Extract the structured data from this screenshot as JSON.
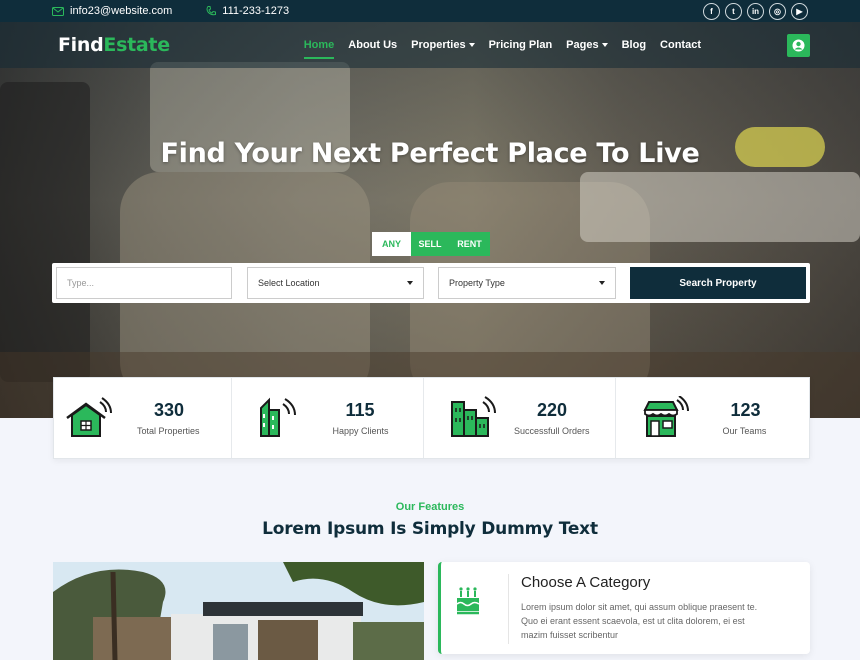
{
  "topbar": {
    "email": "info23@website.com",
    "phone": "111-233-1273",
    "socials": [
      {
        "name": "facebook-icon",
        "glyph": "f"
      },
      {
        "name": "twitter-icon",
        "glyph": "t"
      },
      {
        "name": "linkedin-icon",
        "glyph": "in"
      },
      {
        "name": "instagram-icon",
        "glyph": "◎"
      },
      {
        "name": "youtube-icon",
        "glyph": "▶"
      }
    ]
  },
  "brand": {
    "part1": "Find",
    "part2": "Estate"
  },
  "nav": {
    "items": [
      {
        "label": "Home",
        "active": true,
        "dropdown": false
      },
      {
        "label": "About Us",
        "active": false,
        "dropdown": false
      },
      {
        "label": "Properties",
        "active": false,
        "dropdown": true
      },
      {
        "label": "Pricing Plan",
        "active": false,
        "dropdown": false
      },
      {
        "label": "Pages",
        "active": false,
        "dropdown": true
      },
      {
        "label": "Blog",
        "active": false,
        "dropdown": false
      },
      {
        "label": "Contact",
        "active": false,
        "dropdown": false
      }
    ]
  },
  "hero": {
    "title": "Find Your Next Perfect Place To Live",
    "tabs": [
      "ANY",
      "SELL",
      "RENT"
    ],
    "search": {
      "type_placeholder": "Type...",
      "location_value": "Select Location",
      "property_type_value": "Property Type",
      "button_label": "Search Property"
    }
  },
  "stats": [
    {
      "value": "330",
      "label": "Total Properties",
      "icon": "house-signal-icon"
    },
    {
      "value": "115",
      "label": "Happy Clients",
      "icon": "building-signal-icon"
    },
    {
      "value": "220",
      "label": "Successfull Orders",
      "icon": "city-signal-icon"
    },
    {
      "value": "123",
      "label": "Our Teams",
      "icon": "store-signal-icon"
    }
  ],
  "features": {
    "eyebrow": "Our Features",
    "title": "Lorem Ipsum Is Simply Dummy Text",
    "card": {
      "title": "Choose A Category",
      "text": "Lorem ipsum dolor sit amet, qui assum oblique praesent te. Quo ei erant essent scaevola, est ut clita dolorem, ei est mazim fuisset scribentur",
      "icon": "category-icon"
    }
  },
  "colors": {
    "accent": "#2bb85b",
    "navy": "#0f2d3b",
    "background": "#f3f5fb"
  }
}
